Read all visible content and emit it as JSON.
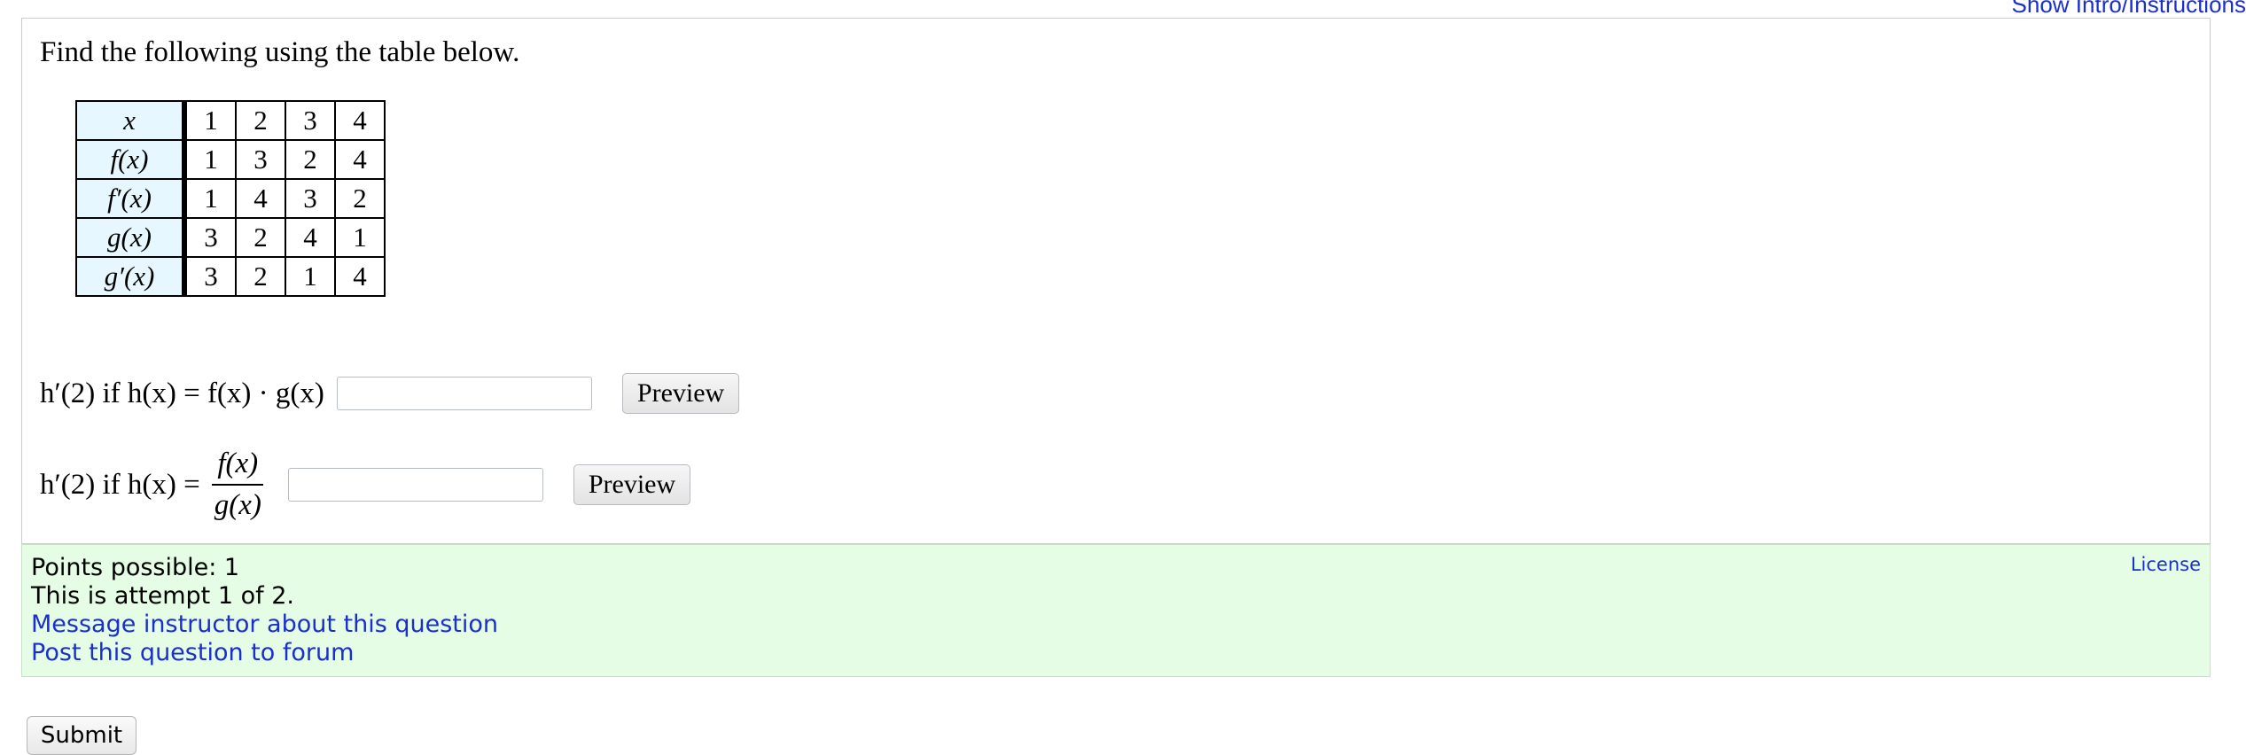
{
  "header": {
    "show_intro_link": "Show Intro/Instructions"
  },
  "question": {
    "prompt": "Find the following using the table below.",
    "table": {
      "rows": [
        {
          "label": "x",
          "values": [
            "1",
            "2",
            "3",
            "4"
          ]
        },
        {
          "label": "f(x)",
          "values": [
            "1",
            "3",
            "2",
            "4"
          ]
        },
        {
          "label": "f′(x)",
          "values": [
            "1",
            "4",
            "3",
            "2"
          ]
        },
        {
          "label": "g(x)",
          "values": [
            "3",
            "2",
            "4",
            "1"
          ]
        },
        {
          "label": "g′(x)",
          "values": [
            "3",
            "2",
            "1",
            "4"
          ]
        }
      ]
    },
    "parts": [
      {
        "lead": "h′(2) if h(x) = f(x) · g(x)",
        "answer_value": "",
        "preview_label": "Preview"
      },
      {
        "lead": "h′(2) if h(x) =",
        "numerator": "f(x)",
        "denominator": "g(x)",
        "answer_value": "",
        "preview_label": "Preview"
      }
    ]
  },
  "info": {
    "points": "Points possible: 1",
    "attempt": "This is attempt 1 of 2.",
    "message_link": "Message instructor about this question",
    "forum_link": "Post this question to forum",
    "license_link": "License"
  },
  "footer": {
    "submit_label": "Submit"
  },
  "colors": {
    "link": "#1a2fd0",
    "info_bg": "#e4fde4",
    "row_header_bg": "#e6f7ff"
  }
}
